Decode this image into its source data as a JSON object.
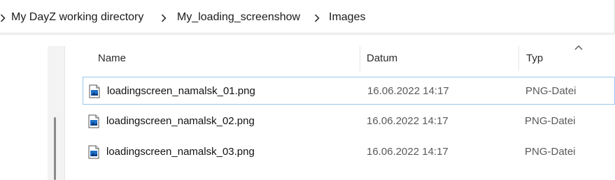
{
  "breadcrumb": {
    "items": [
      {
        "label": "My DayZ working directory"
      },
      {
        "label": "My_loading_screenshow"
      },
      {
        "label": "Images"
      }
    ]
  },
  "columns": {
    "name": "Name",
    "date": "Datum",
    "type": "Typ"
  },
  "files": [
    {
      "name": "loadingscreen_namalsk_01.png",
      "date": "16.06.2022 14:17",
      "type": "PNG-Datei"
    },
    {
      "name": "loadingscreen_namalsk_02.png",
      "date": "16.06.2022 14:17",
      "type": "PNG-Datei"
    },
    {
      "name": "loadingscreen_namalsk_03.png",
      "date": "16.06.2022 14:17",
      "type": "PNG-Datei"
    }
  ],
  "colors": {
    "selection_border": "#99c7ee",
    "icon_blue": "#1e6fc8"
  }
}
